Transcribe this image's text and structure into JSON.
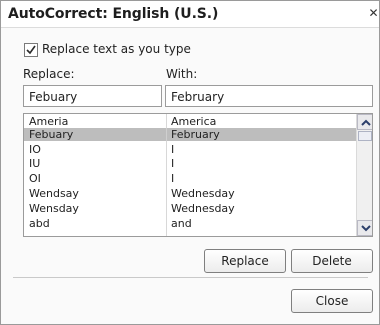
{
  "window": {
    "title": "AutoCorrect: English (U.S.)",
    "close_glyph": "✕"
  },
  "checkbox": {
    "label": "Replace text as you type",
    "checked": true
  },
  "labels": {
    "replace": "Replace:",
    "with": "With:"
  },
  "fields": {
    "replace_value": "Febuary",
    "with_value": "February"
  },
  "list": {
    "rows": [
      {
        "replace": "Ameria",
        "with": "America",
        "selected": false
      },
      {
        "replace": "Febuary",
        "with": "February",
        "selected": true
      },
      {
        "replace": "IO",
        "with": "I",
        "selected": false
      },
      {
        "replace": "IU",
        "with": "I",
        "selected": false
      },
      {
        "replace": "OI",
        "with": "I",
        "selected": false
      },
      {
        "replace": "Wendsay",
        "with": "Wednesday",
        "selected": false
      },
      {
        "replace": "Wensday",
        "with": "Wednesday",
        "selected": false
      },
      {
        "replace": "abd",
        "with": "and",
        "selected": false
      }
    ]
  },
  "buttons": {
    "replace": "Replace",
    "delete": "Delete",
    "close": "Close"
  }
}
